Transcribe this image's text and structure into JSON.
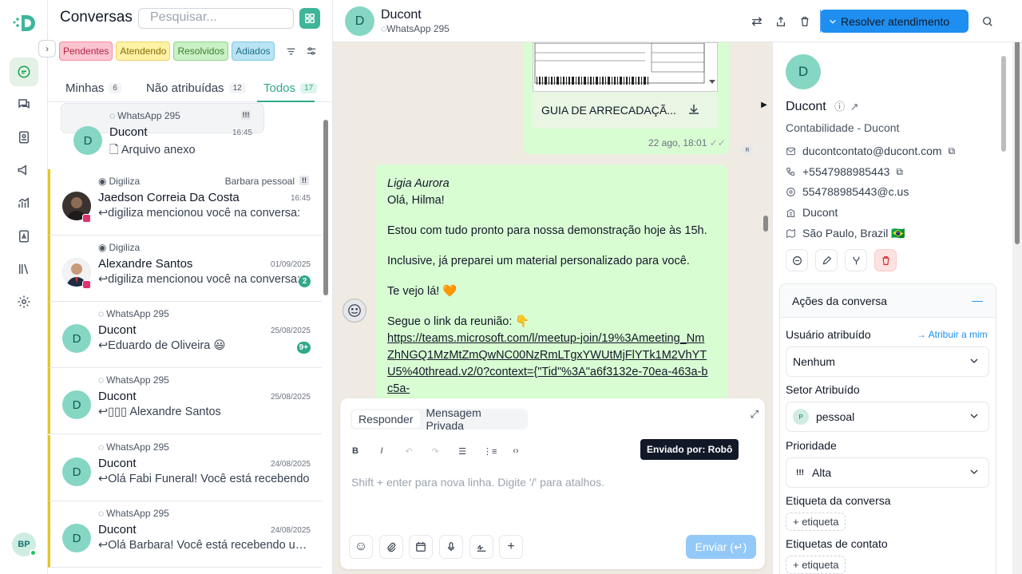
{
  "colors": {
    "accent": "#2fa98a",
    "primary": "#1f8ef1",
    "pending_bar": "#e3c523",
    "bubble": "#d9fdd3"
  },
  "nav": {
    "items": [
      "chat-bubble-icon",
      "conversations-icon",
      "contacts-icon",
      "campaign-icon",
      "reports-icon",
      "contact-card-icon",
      "library-icon",
      "settings-icon"
    ],
    "user_initials": "BP"
  },
  "list": {
    "title": "Conversas",
    "search_placeholder": "Pesquisar...",
    "filters": [
      "Pendentes",
      "Atendendo",
      "Resolvidos",
      "Adiados"
    ],
    "tabs": [
      {
        "label": "Minhas",
        "count": "6"
      },
      {
        "label": "Não atribuídas",
        "count": "12"
      },
      {
        "label": "Todos",
        "count": "17"
      }
    ],
    "conversations": [
      {
        "source": "WhatsApp 295",
        "agent": "",
        "priority": "!!!",
        "name": "Ducont",
        "time": "16:45",
        "message": "Arquivo anexo",
        "initial": "D",
        "badge": ""
      },
      {
        "source": "Digiliza",
        "agent": "Barbara pessoal",
        "priority": "!!",
        "name": "Jaedson Correia Da Costa",
        "time": "16:45",
        "message": "digiliza mencionou você na conversa:",
        "initial": "",
        "badge": ""
      },
      {
        "source": "Digiliza",
        "agent": "",
        "priority": "",
        "name": "Alexandre Santos",
        "time": "01/09/2025",
        "message": "digiliza mencionou você na conversa:",
        "initial": "",
        "badge": "2"
      },
      {
        "source": "WhatsApp 295",
        "agent": "",
        "priority": "",
        "name": "Ducont",
        "time": "25/08/2025",
        "message": "Eduardo de Oliveira 😃",
        "initial": "D",
        "badge": "9+"
      },
      {
        "source": "WhatsApp 295",
        "agent": "",
        "priority": "",
        "name": "Ducont",
        "time": "25/08/2025",
        "message": "▯▯▯ Alexandre Santos",
        "initial": "D",
        "badge": ""
      },
      {
        "source": "WhatsApp 295",
        "agent": "",
        "priority": "",
        "name": "Ducont",
        "time": "24/08/2025",
        "message": "Olá Fabi Funeral! Você está recebendo",
        "initial": "D",
        "badge": ""
      },
      {
        "source": "WhatsApp 295",
        "agent": "",
        "priority": "",
        "name": "Ducont",
        "time": "24/08/2025",
        "message": "Olá Barbara! Você está recebendo uma",
        "initial": "D",
        "badge": ""
      }
    ]
  },
  "chat": {
    "contact_name": "Ducont",
    "contact_initial": "D",
    "channel": "WhatsApp 295",
    "resolve_label": "Resolver atendimento",
    "doc_name": "GUIA DE ARRECADAÇÃ...",
    "doc_time": "22 ago, 18:01",
    "doc_sender_initial": "R",
    "message": {
      "author": "Ligia Aurora",
      "greeting": "Olá, Hilma!",
      "p1": "Estou com tudo pronto para nossa demonstração hoje às 15h.",
      "p2": "Inclusive, já preparei um material personalizado para você.",
      "p3": "Te vejo lá! 🧡",
      "p4": "Segue o link da reunião: 👇",
      "link": "https://teams.microsoft.com/l/meetup-join/19%3Ameeting_NmZhNGQ1MzMtZmQwNC00NzRmLTgxYWUtMjFlYTk1M2VhYTU5%40thread.v2/0?context={\"Tid\"%3A\"a6f3132e-70ea-463a-bc5a-"
    },
    "composer": {
      "mode_reply": "Responder",
      "mode_private": "Mensagem Privada",
      "placeholder": "Shift + enter para nova linha. Digite '/' para atalhos.",
      "send_label": "Enviar (↵)",
      "tooltip": "Enviado por: Robô"
    }
  },
  "panel": {
    "initial": "D",
    "name": "Ducont",
    "company": "Contabilidade - Ducont",
    "email": "ducontcontato@ducont.com",
    "phone": "+5547988985443",
    "whatsapp_id": "554788985443@c.us",
    "org": "Ducont",
    "location": "São Paulo, Brazil 🇧🇷",
    "actions_title": "Ações da conversa",
    "assigned_user_label": "Usuário atribuído",
    "assign_me": "Atribuir a mim",
    "assigned_user": "Nenhum",
    "sector_label": "Setor Atribuído",
    "sector_initial": "P",
    "sector": "pessoal",
    "priority_label": "Prioridade",
    "priority_icon": "!!!",
    "priority": "Alta",
    "conv_tag_label": "Etiqueta da conversa",
    "contact_tag_label": "Etiquetas de contato",
    "add_tag": "+ etiqueta"
  }
}
